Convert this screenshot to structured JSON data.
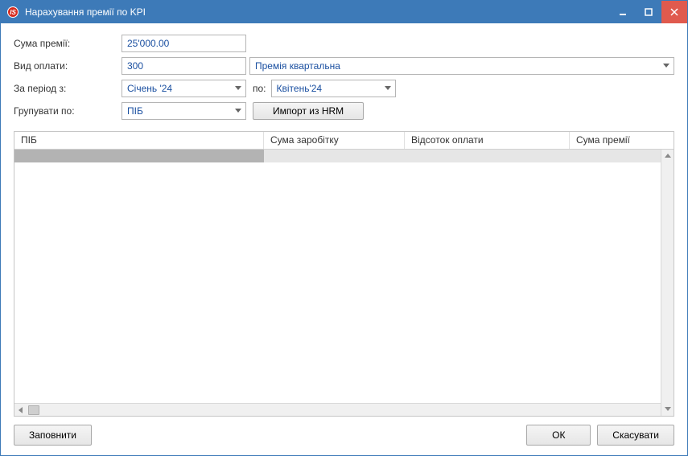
{
  "window": {
    "title": "Нарахування премії по KPI"
  },
  "form": {
    "amount_label": "Сума премії:",
    "amount_value": "25'000.00",
    "paytype_label": "Вид оплати:",
    "paytype_code": "300",
    "paytype_name": "Премія квартальна",
    "period_from_label": "За період з:",
    "period_from_value": "Січень '24",
    "period_to_label": "по:",
    "period_to_value": "Квітень'24",
    "group_label": "Групувати по:",
    "group_value": "ПІБ",
    "import_btn": "Импорт из HRM"
  },
  "grid": {
    "columns": [
      "ПІБ",
      "Сума заробітку",
      "Відсоток оплати",
      "Сума премії"
    ]
  },
  "footer": {
    "fill": "Заповнити",
    "ok": "ОК",
    "cancel": "Скасувати"
  }
}
